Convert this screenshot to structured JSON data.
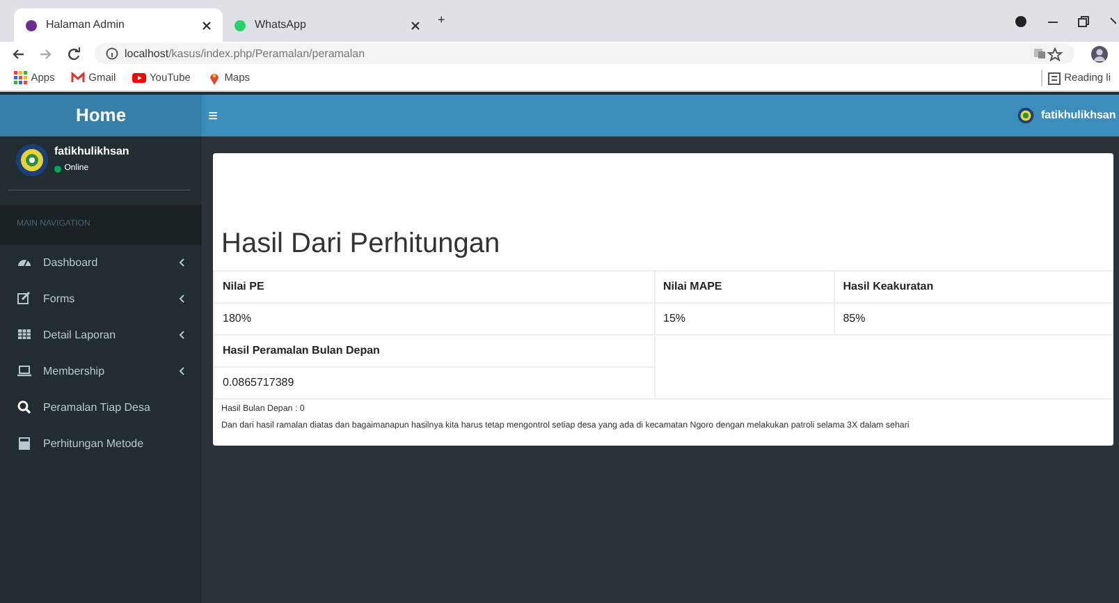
{
  "browser": {
    "tabs": [
      {
        "title": "Halaman Admin",
        "selected": true
      },
      {
        "title": "WhatsApp",
        "selected": false
      }
    ],
    "new_tab": "+",
    "url_host": "localhost",
    "url_path": "/kasus/index.php/Peramalan/peramalan",
    "bookmarks": [
      {
        "label": "Apps",
        "kind": "apps"
      },
      {
        "label": "Gmail",
        "kind": "gmail"
      },
      {
        "label": "YouTube",
        "kind": "youtube"
      },
      {
        "label": "Maps",
        "kind": "maps"
      }
    ],
    "reading_list": "Reading li"
  },
  "header": {
    "logo": "Home",
    "menu_toggle": "≡",
    "user": "fatikhulikhsan"
  },
  "sidebar": {
    "user": {
      "name": "fatikhulikhsan",
      "status": "Online"
    },
    "section": "MAIN NAVIGATION",
    "items": [
      {
        "label": "Dashboard",
        "expandable": true
      },
      {
        "label": "Forms",
        "expandable": true
      },
      {
        "label": "Detail Laporan",
        "expandable": true
      },
      {
        "label": "Membership",
        "expandable": true
      },
      {
        "label": "Peramalan Tiap Desa",
        "expandable": false
      },
      {
        "label": "Perhitungan Metode",
        "expandable": false
      }
    ]
  },
  "content": {
    "title": "Hasil Dari Perhitungan",
    "table": {
      "columns": [
        "Nilai PE",
        "Nilai MAPE",
        "Hasil Keakuratan"
      ],
      "row": [
        "180%",
        "15%",
        "85%"
      ]
    },
    "forecast": {
      "heading": "Hasil Peramalan Bulan Depan",
      "value": "0.0865717389"
    },
    "notes": [
      "Hasil Bulan Depan : 0",
      "Dan dari hasil ramalan diatas dan bagaimanapun hasilnya kita harus tetap mengontrol setiap desa yang ada di kecamatan Ngoro dengan melakukan patroli selama 3X dalam sehari"
    ]
  }
}
